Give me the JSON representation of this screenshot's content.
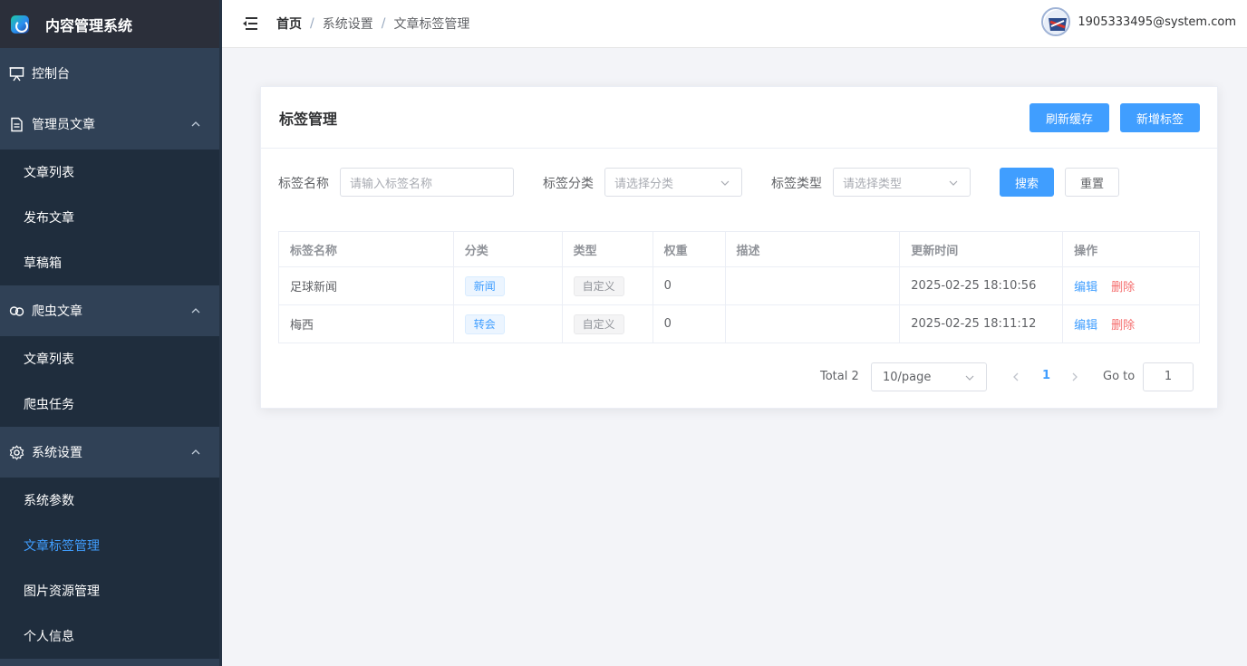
{
  "app": {
    "title": "内容管理系统"
  },
  "sidebar": {
    "dashboard": "控制台",
    "groups": [
      {
        "title": "管理员文章",
        "icon": "document-icon",
        "items": [
          "文章列表",
          "发布文章",
          "草稿箱"
        ]
      },
      {
        "title": "爬虫文章",
        "icon": "link-icon",
        "items": [
          "文章列表",
          "爬虫任务"
        ]
      },
      {
        "title": "系统设置",
        "icon": "gear-icon",
        "items": [
          "系统参数",
          "文章标签管理",
          "图片资源管理",
          "个人信息"
        ]
      }
    ],
    "active_item": "文章标签管理"
  },
  "header": {
    "breadcrumb": [
      "首页",
      "系统设置",
      "文章标签管理"
    ],
    "breadcrumb_separator": "/",
    "user_email": "1905333495@system.com"
  },
  "card": {
    "title": "标签管理",
    "refresh_button": "刷新缓存",
    "add_button": "新增标签"
  },
  "filters": {
    "name_label": "标签名称",
    "name_placeholder": "请输入标签名称",
    "category_label": "标签分类",
    "category_placeholder": "请选择分类",
    "type_label": "标签类型",
    "type_placeholder": "请选择类型",
    "search_button": "搜索",
    "reset_button": "重置"
  },
  "table": {
    "columns": [
      "标签名称",
      "分类",
      "类型",
      "权重",
      "描述",
      "更新时间",
      "操作"
    ],
    "rows": [
      {
        "name": "足球新闻",
        "category": "新闻",
        "type": "自定义",
        "weight": "0",
        "description": "",
        "updated": "2025-02-25 18:10:56"
      },
      {
        "name": "梅西",
        "category": "转会",
        "type": "自定义",
        "weight": "0",
        "description": "",
        "updated": "2025-02-25 18:11:12"
      }
    ],
    "edit_label": "编辑",
    "delete_label": "删除"
  },
  "pagination": {
    "total": "Total 2",
    "page_size": "10/page",
    "current_page": "1",
    "goto_label": "Go to",
    "goto_value": "1"
  },
  "colors": {
    "sidebar_bg": "#304156",
    "sidebar_sub_bg": "#1f2d3d",
    "primary": "#409eff",
    "danger": "#f56c6c"
  }
}
